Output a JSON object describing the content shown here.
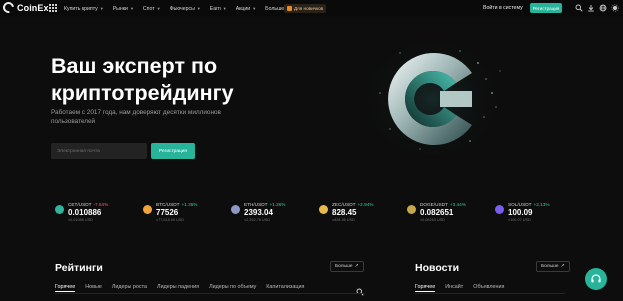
{
  "nav": {
    "brand": "CoinEx",
    "menu": [
      {
        "label": "Купить крипту",
        "chevron": true
      },
      {
        "label": "Рынки",
        "chevron": true
      },
      {
        "label": "Спот",
        "chevron": true
      },
      {
        "label": "Фьючерсы",
        "chevron": true
      },
      {
        "label": "Earn",
        "chevron": true
      },
      {
        "label": "Акции",
        "chevron": true
      },
      {
        "label": "Больше",
        "chevron": true
      }
    ],
    "promo_label": "Для новичков",
    "login_label": "Войти в систему",
    "register_label": "Регистрация",
    "icons": [
      "search-icon",
      "download-icon",
      "globe-icon",
      "theme-icon"
    ]
  },
  "hero": {
    "title_line1": "Ваш эксперт по",
    "title_line2": "криптотрейдингу",
    "subtitle": "Работаем с 2017 года, нам доверяют десятки миллионов пользователей",
    "email_placeholder": "Электронная почта",
    "register_label": "Регистрация"
  },
  "tickers": [
    {
      "pair": "CET/USDT",
      "change": "-7.94%",
      "price": "0.010886",
      "usd": "≈0.01086 USD",
      "dir": "neg",
      "coin_color": "#2fb59d"
    },
    {
      "pair": "BTC/USDT",
      "change": "+1.35%",
      "price": "77526",
      "usd": "≈77,515.00 USD",
      "dir": "pos",
      "coin_color": "#f2a33a"
    },
    {
      "pair": "ETH/USDT",
      "change": "+1.26%",
      "price": "2393.04",
      "usd": "≈2,392.78 USD",
      "dir": "pos",
      "coin_color": "#8e98c6"
    },
    {
      "pair": "ZEC/USDT",
      "change": "+2.94%",
      "price": "828.45",
      "usd": "≈828.36 USD",
      "dir": "pos",
      "coin_color": "#e9b84a"
    },
    {
      "pair": "DOGE/USDT",
      "change": "+3.44%",
      "price": "0.082651",
      "usd": "≈0.08263 USD",
      "dir": "pos",
      "coin_color": "#c6a74a"
    },
    {
      "pair": "SOL/USDT",
      "change": "+2.13%",
      "price": "100.09",
      "usd": "≈100.07 USD",
      "dir": "pos",
      "coin_color": "#7a5cf0"
    }
  ],
  "ratings": {
    "title": "Рейтинги",
    "more_label": "Больше",
    "tabs": [
      "Горячее",
      "Новые",
      "Лидеры роста",
      "Лидеры падения",
      "Лидеры по объему",
      "Капитализация"
    ],
    "active_tab": 0
  },
  "news": {
    "title": "Новости",
    "more_label": "Больше",
    "tabs": [
      "Горячее",
      "Инсайт",
      "Объявления"
    ],
    "active_tab": 0
  },
  "colors": {
    "accent": "#27b49a",
    "negative": "#f0616d",
    "positive": "#2fd09a",
    "background": "#0d0d0d"
  }
}
